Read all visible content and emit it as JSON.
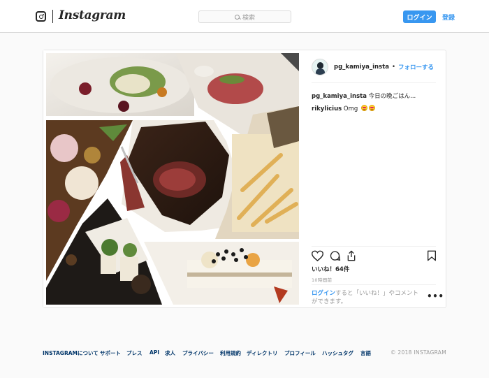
{
  "header": {
    "brand": "Instagram",
    "search_placeholder": "検索",
    "login_label": "ログイン",
    "signup_label": "登録"
  },
  "post": {
    "username": "pg_kamiya_insta",
    "separator": "•",
    "follow_label": "フォローする",
    "caption_user": "pg_kamiya_insta",
    "caption_text": "今日の晩ごはん...",
    "comment_user": "rikylicius",
    "comment_text": "Omg",
    "likes": "いいね！64件",
    "time_ago": "10時間前",
    "login_link": "ログイン",
    "login_prompt": "すると「いいね！」やコメントができます。",
    "more_label": "•••"
  },
  "footer": {
    "links": [
      "INSTAGRAMについて",
      "サポート",
      "プレス",
      "API",
      "求人",
      "プライバシー",
      "利用規約",
      "ディレクトリ",
      "プロフィール",
      "ハッシュタグ",
      "言語"
    ],
    "copyright": "© 2018 INSTAGRAM"
  },
  "colors": {
    "accent": "#3897f0",
    "footer_link": "#003569",
    "border": "#dbdbdb"
  },
  "icons": {
    "heart": "heart-icon",
    "comment": "comment-icon",
    "share": "share-icon",
    "bookmark": "bookmark-icon",
    "camera": "camera-logo-icon"
  }
}
